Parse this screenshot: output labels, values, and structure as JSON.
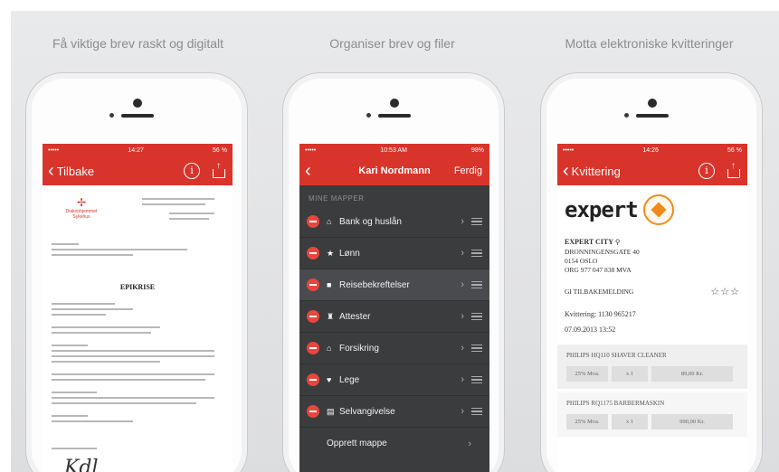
{
  "captions": [
    "Få viktige brev raskt og digitalt",
    "Organiser brev og filer",
    "Motta elektroniske kvitteringer"
  ],
  "phone1": {
    "status": {
      "carrier": "•••••",
      "time": "14:27",
      "battery": "56 %"
    },
    "nav": {
      "back_label": "Tilbake"
    },
    "document": {
      "hospital": "Diakonhjemmet Sykehus",
      "title": "EPIKRISE"
    }
  },
  "phone2": {
    "status": {
      "carrier": "•••••",
      "time": "10:53 AM",
      "battery": "98%"
    },
    "nav": {
      "title": "Kari Nordmann",
      "done_label": "Ferdig"
    },
    "section_header": "MINE MAPPER",
    "folders": [
      {
        "label": "Bank og huslån",
        "icon": "home-icon"
      },
      {
        "label": "Lønn",
        "icon": "star-icon"
      },
      {
        "label": "Reisebekreftelser",
        "icon": "briefcase-icon"
      },
      {
        "label": "Attester",
        "icon": "trophy-icon"
      },
      {
        "label": "Forsikring",
        "icon": "home-icon"
      },
      {
        "label": "Lege",
        "icon": "heart-icon"
      },
      {
        "label": "Selvangivelse",
        "icon": "document-icon"
      }
    ],
    "create_label": "Opprett mappe"
  },
  "phone3": {
    "status": {
      "carrier": "•••••",
      "time": "14:26",
      "battery": "56 %"
    },
    "nav": {
      "back_label": "Kvittering"
    },
    "receipt": {
      "brand": "expert",
      "store_name": "EXPERT CITY",
      "address_1": "DRONNINGENSGATE 40",
      "address_2": "0154 OSLO",
      "org": "ORG 977 047 838 MVA",
      "return_label": "GI TILBAKEMELDING",
      "receipt_no": "Kvittering: 1130 965217",
      "date": "07.09.2013 13:52",
      "items": [
        {
          "name": "PHILIPS HQ110 SHAVER CLEANER",
          "vat": "25% Mva.",
          "qty": "x 1",
          "price": "89,00 Kr."
        },
        {
          "name": "PHILIPS RQ1175 BARBERMASKIN",
          "vat": "25% Mva.",
          "qty": "x 1",
          "price": "990,00 Kr."
        }
      ]
    }
  }
}
